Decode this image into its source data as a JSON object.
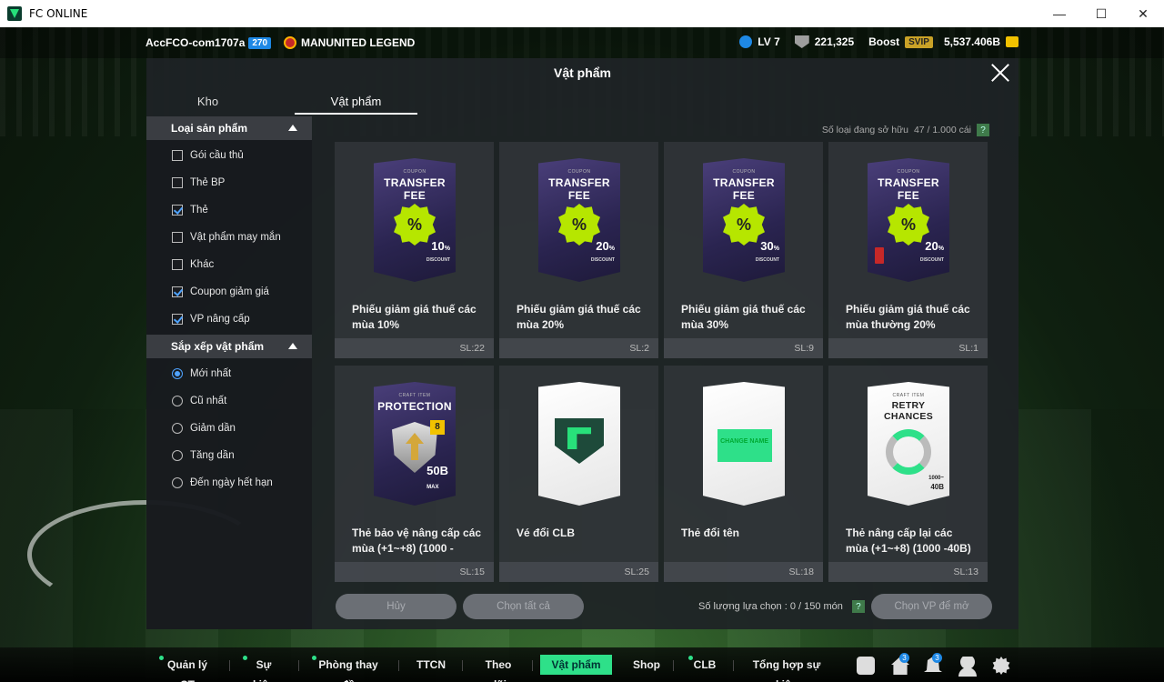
{
  "window": {
    "title": "FC ONLINE",
    "min": "—",
    "max": "☐",
    "close": "✕"
  },
  "topbar": {
    "account": "AccFCO-com1707a",
    "account_badge": "270",
    "club": "MANUNITED LEGEND",
    "level": "LV 7",
    "points": "221,325",
    "boost": "Boost",
    "svip": "SVIP",
    "coins": "5,537.406B"
  },
  "modal": {
    "title": "Vật phẩm",
    "tabs": [
      "Kho",
      "Vật phẩm"
    ],
    "own_count_label": "Số loại đang sở hữu",
    "own_count_value": "47 / 1.000 cái",
    "help": "?"
  },
  "sidebar": {
    "section1": {
      "title": "Loại sản phẩm",
      "items": [
        {
          "label": "Gói cầu thủ",
          "checked": false
        },
        {
          "label": "Thẻ BP",
          "checked": false
        },
        {
          "label": "Thẻ",
          "checked": true
        },
        {
          "label": "Vật phẩm may mắn",
          "checked": false
        },
        {
          "label": "Khác",
          "checked": false
        },
        {
          "label": "Coupon giảm giá",
          "checked": true
        },
        {
          "label": "VP nâng cấp",
          "checked": true
        }
      ]
    },
    "section2": {
      "title": "Sắp xếp vật phẩm",
      "items": [
        {
          "label": "Mới nhất",
          "selected": true
        },
        {
          "label": "Cũ nhất",
          "selected": false
        },
        {
          "label": "Giảm dần",
          "selected": false
        },
        {
          "label": "Tăng dần",
          "selected": false
        },
        {
          "label": "Đến ngày hết hạn",
          "selected": false
        }
      ]
    }
  },
  "items": [
    {
      "name": "Phiếu giảm giá thuế các mùa 10%",
      "qty": "SL:22",
      "small": "COUPON",
      "big": "TRANSFER FEE",
      "disc": "10",
      "disc_unit": "%",
      "disc_label": "DISCOUNT",
      "pct": "%"
    },
    {
      "name": "Phiếu giảm giá thuế các mùa 20%",
      "qty": "SL:2",
      "small": "COUPON",
      "big": "TRANSFER FEE",
      "disc": "20",
      "disc_unit": "%",
      "disc_label": "DISCOUNT",
      "pct": "%"
    },
    {
      "name": "Phiếu giảm giá thuế các mùa 30%",
      "qty": "SL:9",
      "small": "COUPON",
      "big": "TRANSFER FEE",
      "disc": "30",
      "disc_unit": "%",
      "disc_label": "DISCOUNT",
      "pct": "%"
    },
    {
      "name": "Phiếu giảm giá thuế các mùa thường 20%",
      "qty": "SL:1",
      "small": "COUPON",
      "big": "TRANSFER FEE",
      "disc": "20",
      "disc_unit": "%",
      "disc_label": "DISCOUNT",
      "pct": "%"
    },
    {
      "name": "Thẻ bảo vệ nâng cấp các mùa (+1~+8) (1000 -",
      "qty": "SL:15",
      "small": "CRAFT ITEM",
      "big": "PROTECTION",
      "level": "8",
      "value": "50B",
      "value_label": "MAX"
    },
    {
      "name": "Vé đổi CLB",
      "qty": "SL:25"
    },
    {
      "name": "Thẻ đổi tên",
      "qty": "SL:18",
      "tag": "CHANGE NAME"
    },
    {
      "name": "Thẻ nâng cấp lại các mùa (+1~+8) (1000 -40B)",
      "qty": "SL:13",
      "small": "CRAFT ITEM",
      "big": "RETRY CHANCES",
      "range1": "1000~",
      "range2": "40B"
    }
  ],
  "footer": {
    "cancel": "Hủy",
    "select_all": "Chọn tất cả",
    "selection_label": "Số lượng lựa chọn : 0 / 150 món",
    "open": "Chọn VP để mở"
  },
  "nav": {
    "items": [
      "Quản lý CT",
      "Sự kiện",
      "Phòng thay đồ",
      "TTCN",
      "Theo dõi",
      "Vật phẩm",
      "Shop",
      "CLB",
      "Tổng hợp sự kiện"
    ],
    "badge_home": "3",
    "badge_bell": "3"
  }
}
